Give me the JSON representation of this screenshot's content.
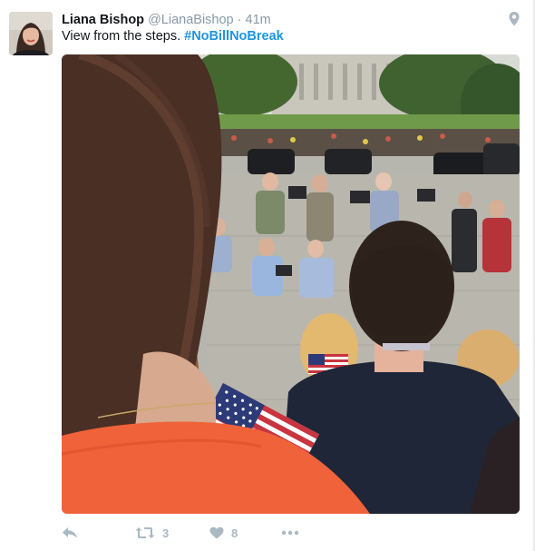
{
  "tweet": {
    "author": {
      "name": "Liana Bishop",
      "handle": "@LianaBishop",
      "separator": "·",
      "timestamp": "41m"
    },
    "text": "View from the steps.",
    "hashtag": "#NoBillNoBreak",
    "media": {
      "subject": "crowd-with-american-flag-on-capitol-steps",
      "colors": {
        "shirt": "#f0623a",
        "sky": "#d9dcd6",
        "grass": "#6f9a4a",
        "plaza": "#b9b7ad",
        "jacket": "#1f2637"
      }
    },
    "actions": {
      "reply_icon": "reply-icon",
      "retweet_icon": "retweet-icon",
      "retweet_count": "3",
      "like_icon": "heart-icon",
      "like_count": "8",
      "more_icon": "more-icon"
    },
    "colors": {
      "accent": "#1b95e0",
      "muted": "#8899a6",
      "action_gray": "#aab8c2"
    }
  }
}
